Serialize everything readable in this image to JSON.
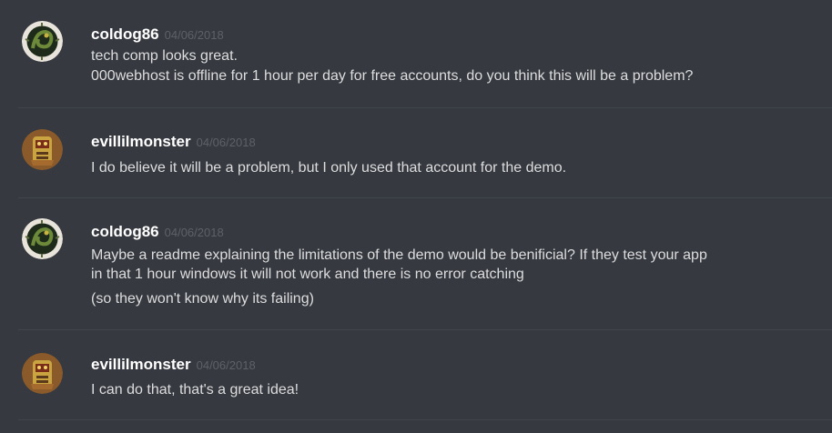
{
  "messages": [
    {
      "username": "coldog86",
      "timestamp": "04/06/2018",
      "avatar": "dragon-avatar",
      "lines": [
        "tech comp looks great.",
        "000webhost is offline for 1 hour per day for free accounts, do you think this will be a problem?"
      ]
    },
    {
      "username": "evillilmonster",
      "timestamp": "04/06/2018",
      "avatar": "monster-avatar",
      "lines": [
        "I do believe it will be a problem, but I only used that account for the demo."
      ]
    },
    {
      "username": "coldog86",
      "timestamp": "04/06/2018",
      "avatar": "dragon-avatar",
      "lines": [
        "Maybe a readme explaining the limitations of the demo would be benificial? If they test your app",
        "in that 1 hour windows it will not work and there is no error catching",
        "(so they won't know why its failing)"
      ]
    },
    {
      "username": "evillilmonster",
      "timestamp": "04/06/2018",
      "avatar": "monster-avatar",
      "lines": [
        "I can do that, that's a great idea!"
      ]
    }
  ],
  "colors": {
    "background": "#36393f",
    "username": "#ffffff",
    "timestamp": "#5e6168",
    "text": "#dcddde",
    "divider": "#40444b"
  }
}
